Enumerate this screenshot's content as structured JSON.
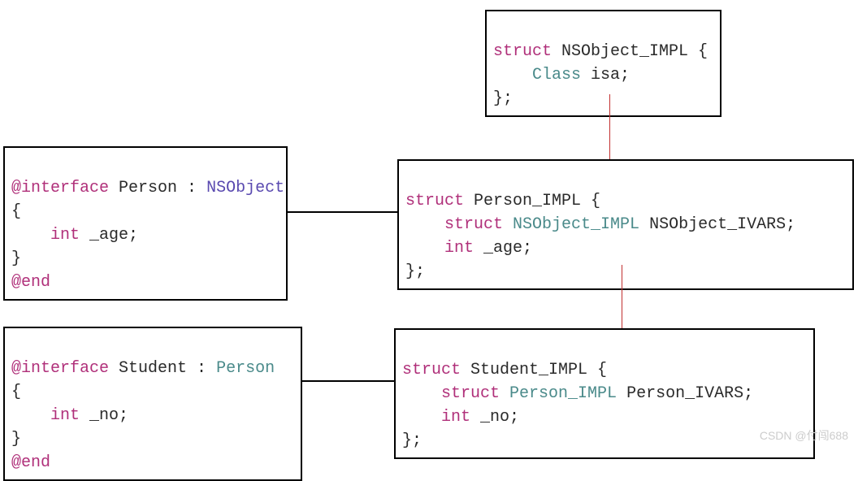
{
  "nsobject": {
    "l1_struct": "struct",
    "l1_name": " NSObject_IMPL {",
    "l2_indent": "    ",
    "l2_class": "Class",
    "l2_isa": " isa;",
    "l3": "};"
  },
  "personIface": {
    "l1_at": "@interface",
    "l1_name": " Person : ",
    "l1_super": "NSObject",
    "l2": "{",
    "l3_indent": "    ",
    "l3_int": "int",
    "l3_var": " _age;",
    "l4": "}",
    "l5_end": "@end"
  },
  "personImpl": {
    "l1_struct": "struct",
    "l1_name": " Person_IMPL {",
    "l2_indent": "    ",
    "l2_struct": "struct",
    "l2_type": " NSObject_IMPL",
    "l2_var": " NSObject_IVARS;",
    "l3_indent": "    ",
    "l3_int": "int",
    "l3_var": " _age;",
    "l4": "};"
  },
  "studentIface": {
    "l1_at": "@interface",
    "l1_name": " Student : ",
    "l1_super": "Person",
    "l2": "{",
    "l3_indent": "    ",
    "l3_int": "int",
    "l3_var": " _no;",
    "l4": "}",
    "l5_end": "@end"
  },
  "studentImpl": {
    "l1_struct": "struct",
    "l1_name": " Student_IMPL {",
    "l2_indent": "    ",
    "l2_struct": "struct",
    "l2_type": " Person_IMPL",
    "l2_var": " Person_IVARS;",
    "l3_indent": "    ",
    "l3_int": "int",
    "l3_var": " _no;",
    "l4": "};"
  },
  "watermark": "CSDN @付闯688"
}
